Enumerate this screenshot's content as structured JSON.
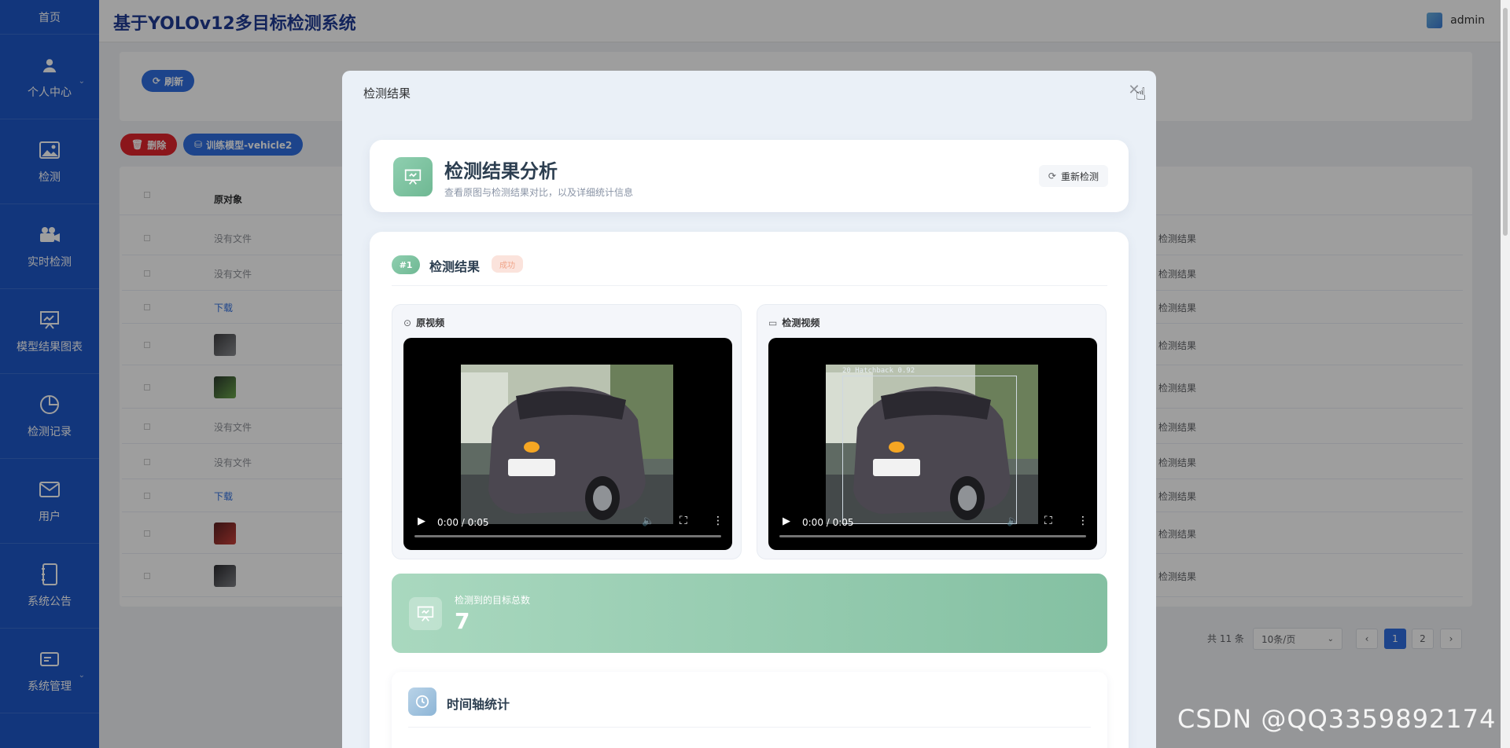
{
  "app": {
    "title": "基于YOLOv12多目标检测系统",
    "user": "admin"
  },
  "sidebar": {
    "items": [
      {
        "label": "首页",
        "icon": "home-icon"
      },
      {
        "label": "个人中心",
        "icon": "user-icon"
      },
      {
        "label": "检测",
        "icon": "image-icon"
      },
      {
        "label": "实时检测",
        "icon": "camera-icon"
      },
      {
        "label": "模型结果图表",
        "icon": "presentation-icon"
      },
      {
        "label": "检测记录",
        "icon": "pie-chart-icon"
      },
      {
        "label": "用户",
        "icon": "mail-icon"
      },
      {
        "label": "系统公告",
        "icon": "notebook-icon"
      },
      {
        "label": "系统管理",
        "icon": "card-icon"
      }
    ]
  },
  "toolbar": {
    "refresh": "刷新",
    "delete": "删除",
    "model": "训练模型-vehicle2"
  },
  "table": {
    "header_col": "原对象",
    "rows": [
      {
        "orig": "没有文件",
        "type": "text",
        "action": "检测结果"
      },
      {
        "orig": "没有文件",
        "type": "text",
        "action": "检测结果"
      },
      {
        "orig": "下载",
        "type": "link",
        "action": "检测结果"
      },
      {
        "orig": "",
        "type": "thumb",
        "action": "检测结果"
      },
      {
        "orig": "",
        "type": "thumb",
        "action": "检测结果"
      },
      {
        "orig": "没有文件",
        "type": "text",
        "action": "检测结果"
      },
      {
        "orig": "没有文件",
        "type": "text",
        "action": "检测结果"
      },
      {
        "orig": "下载",
        "type": "link",
        "action": "检测结果"
      },
      {
        "orig": "",
        "type": "thumb",
        "action": "检测结果"
      },
      {
        "orig": "",
        "type": "thumb",
        "action": "检测结果"
      }
    ]
  },
  "pagination": {
    "total": "共 11 条",
    "page_size": "10条/页",
    "pages": [
      "1",
      "2"
    ],
    "prev": "‹",
    "next": "›"
  },
  "dialog": {
    "title": "检测结果",
    "header": {
      "title": "检测结果分析",
      "subtitle": "查看原图与检测结果对比，以及详细统计信息",
      "redetect": "重新检测"
    },
    "section": {
      "num": "#1",
      "title": "检测结果",
      "status": "成功"
    },
    "original_video": {
      "label": "原视频",
      "time": "0:00 / 0:05"
    },
    "detected_video": {
      "label": "检测视频",
      "time": "0:00 / 0:05",
      "detection": "20 Hatchback 0.92"
    },
    "stat": {
      "label": "检测到的目标总数",
      "value": "7"
    },
    "timeline": {
      "title": "时间轴统计"
    }
  },
  "watermark": "CSDN @QQ3359892174",
  "colors": {
    "sidebar": "#1e58c9",
    "primary": "#2f6fe0",
    "danger": "#e0242c",
    "accent_green": "#84c0a2"
  }
}
